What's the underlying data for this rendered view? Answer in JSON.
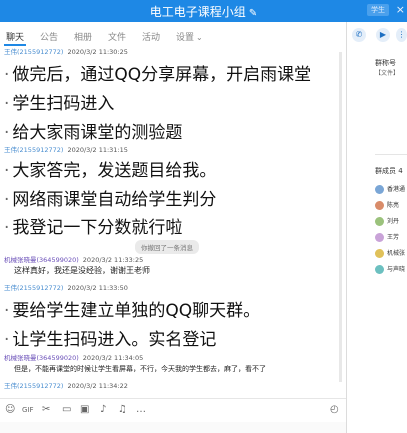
{
  "window": {
    "title": "电工电子课程小组",
    "edit_glyph": "✎",
    "button_label": "学生",
    "close_glyph": "×"
  },
  "tabs": [
    {
      "label": "聊天"
    },
    {
      "label": "公告"
    },
    {
      "label": "相册"
    },
    {
      "label": "文件"
    },
    {
      "label": "活动"
    },
    {
      "label": "设置"
    }
  ],
  "tab_chevron": "⌄",
  "messages": {
    "m1_sender": "王伟(2155912772)",
    "m1_time": "2020/3/2 11:30:25",
    "b1": "做完后，通过QQ分享屏幕，开启雨课堂",
    "b2": "学生扫码进入",
    "b3": "给大家雨课堂的测验题",
    "m2_sender": "王伟(2155912772)",
    "m2_time": "2020/3/2 11:31:15",
    "b4": "大家答完，发送题目给我。",
    "b5": "网络雨课堂自动给学生判分",
    "b6": "我登记一下分数就行啦",
    "notice": "你撤回了一条消息",
    "m3_sender": "机械张晓曼(364599020)",
    "m3_time": "2020/3/2 11:33:25",
    "s1": "这样真好，我还是没经验，谢谢王老师",
    "m4_sender": "王伟(2155912772)",
    "m4_time": "2020/3/2 11:33:50",
    "b7": "要给学生建立单独的QQ聊天群。",
    "b8": "让学生扫码进入。实名登记",
    "m5_sender": "机械张晓曼(364599020)",
    "m5_time": "2020/3/2 11:34:05",
    "s2": "但是，不能再课堂的时候让学生看屏幕，不行，今天我的学生都去，麻了，看不了",
    "m6_sender": "王伟(2155912772)",
    "m6_time": "2020/3/2 11:34:22"
  },
  "right_panel": {
    "title": "群称号",
    "sub_label": "【文件】",
    "members_title": "群成员 4",
    "members": [
      "香港通",
      "陈亮",
      "刘丹",
      "王芳",
      "机械张",
      "与声晓"
    ]
  },
  "colors": {
    "accent": "#1e88e5",
    "sender": "#4a8ed0",
    "sender_alt": "#6a4fb8"
  }
}
